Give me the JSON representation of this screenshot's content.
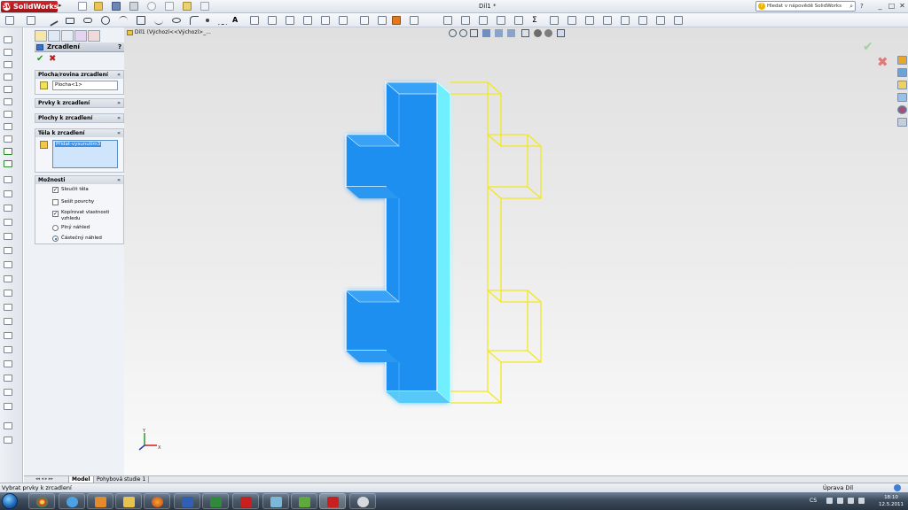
{
  "titlebar": {
    "app_name": "SolidWorks",
    "logo_mark": "SW",
    "document_title": "Díl1 *",
    "help_search_placeholder": "Hledat v nápovědě SolidWorks",
    "help_question": "?"
  },
  "breadcrumb": "Díl1 (Výchozí<<Výchozí>_...",
  "property_manager": {
    "title": "Zrcadlení",
    "help": "?",
    "sections": {
      "mirror_face": {
        "title": "Plocha/rovina zrcadlení",
        "value": "Plocha<1>"
      },
      "features_to_mirror": {
        "title": "Prvky k zrcadlení"
      },
      "faces_to_mirror": {
        "title": "Plochy k zrcadlení"
      },
      "bodies_to_mirror": {
        "title": "Těla k zrcadlení",
        "selected_item": "Přidat-vysunutím3"
      },
      "options": {
        "title": "Možnosti",
        "merge_solids": {
          "label": "Sloučit těla",
          "checked": true
        },
        "knit_surfaces": {
          "label": "Sešít povrchy",
          "checked": false
        },
        "propagate_visual": {
          "label": "Kopírovat vlastnosti vzhledu",
          "label_line1": "Kopírovat vlastnosti",
          "label_line2": "vzhledu",
          "checked": true
        },
        "full_preview": {
          "label": "Plný náhled",
          "selected": false
        },
        "partial_preview": {
          "label": "Částečný náhled",
          "selected": true
        }
      }
    }
  },
  "tabs": [
    {
      "label": "Model",
      "active": true
    },
    {
      "label": "Pohybová studie 1",
      "active": false
    }
  ],
  "statusbar": {
    "left": "Vybrat prvky k zrcadlení",
    "right": "Úprava Díl"
  },
  "taskbar": {
    "language": "CS",
    "time": "18:10",
    "date": "12.5.2011"
  },
  "colors": {
    "model_body": "#1a8ff0",
    "model_highlight": "#6ff0ff",
    "mirror_preview": "#f2e81e",
    "ok_green": "#1e9b1e",
    "cancel_red": "#c31b1b",
    "selection_blue": "#3f8de0"
  },
  "icons": {
    "ok": "✔",
    "cancel": "✖",
    "chevron": "»",
    "search": "⌕",
    "dropdown": "▸"
  }
}
